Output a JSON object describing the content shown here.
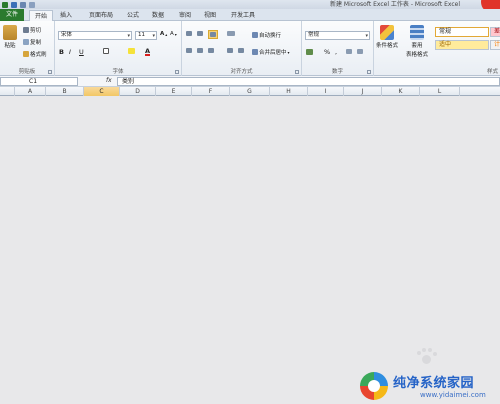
{
  "window": {
    "title": "新建 Microsoft Excel 工作表 - Microsoft Excel"
  },
  "tabs": [
    {
      "label": "文件"
    },
    {
      "label": "开始"
    },
    {
      "label": "插入"
    },
    {
      "label": "页面布局"
    },
    {
      "label": "公式"
    },
    {
      "label": "数据"
    },
    {
      "label": "审阅"
    },
    {
      "label": "视图"
    },
    {
      "label": "开发工具"
    }
  ],
  "ribbon": {
    "clipboard": {
      "label": "剪贴板",
      "paste": "粘贴",
      "cut": "剪切",
      "copy": "复制",
      "format_painter": "格式刷"
    },
    "font": {
      "label": "字体",
      "font_name": "宋体",
      "font_size": "11",
      "bold": "B",
      "italic": "I",
      "underline": "U"
    },
    "alignment": {
      "label": "对齐方式",
      "wrap_text": "自动换行",
      "merge_center": "合并后居中"
    },
    "number": {
      "label": "数字",
      "format": "常规",
      "percent": "%"
    },
    "styles": {
      "label": "样式",
      "conditional_format": "条件格式",
      "format_as_table_line1": "套用",
      "format_as_table_line2": "表格格式",
      "cell_normal": "常规",
      "cell_bad": "差",
      "cell_neutral": "适中",
      "cell_calc": "计"
    }
  },
  "formula_bar": {
    "name_box": "C1",
    "fx": "fx",
    "content": "类别"
  },
  "columns": [
    "A",
    "B",
    "C",
    "D",
    "E",
    "F",
    "G",
    "H",
    "I",
    "J",
    "K",
    "L"
  ],
  "selected_column": "C",
  "watermark": {
    "text": "纯净系统家园",
    "url": "www.yidaimei.com"
  },
  "colors": {
    "file_tab": "#2a7a2e",
    "selected_header": "#f2c766",
    "cell_bad_bg": "#ffc7ce",
    "cell_neutral_bg": "#ffeb9c"
  }
}
